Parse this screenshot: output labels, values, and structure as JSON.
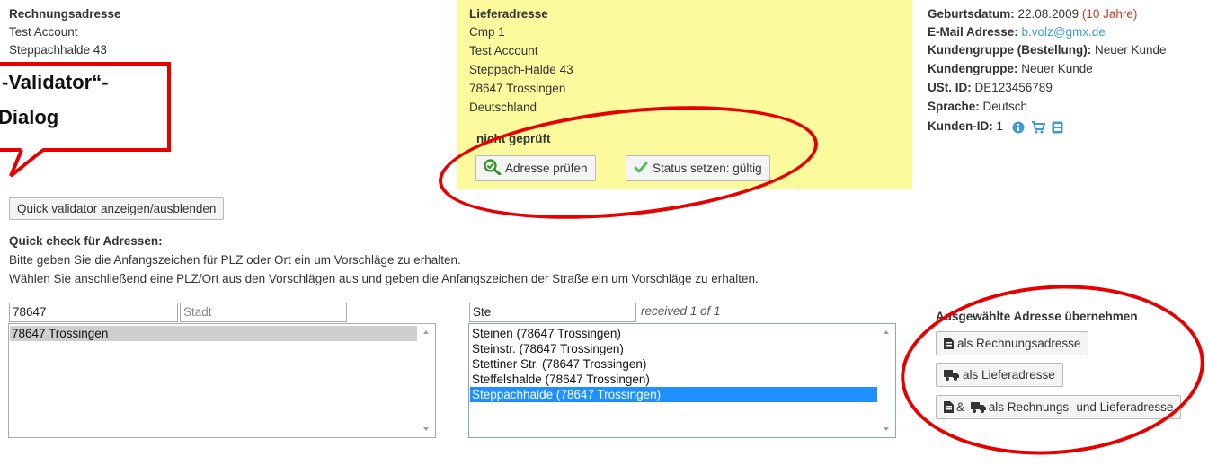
{
  "billing": {
    "heading": "Rechnungsadresse",
    "line1": "Test Account",
    "line2": "Steppachhalde 43"
  },
  "callout": {
    "line1": "-Validator“-",
    "line2": "Dialog"
  },
  "shipping": {
    "heading": "Lieferadresse",
    "line1": "Cmp 1",
    "line2": "Test Account",
    "line3": "Steppach-Halde 43",
    "line4": "78647 Trossingen",
    "line5": "Deutschland",
    "status": "nicht geprüft",
    "check_button": "Adresse prüfen",
    "set_valid_button": "Status setzen: gültig"
  },
  "customer": {
    "birth_label": "Geburtsdatum:",
    "birth_value": " 22.08.2009 ",
    "birth_age": "(10 Jahre)",
    "email_label": "E-Mail Adresse:",
    "email_value": " b.volz@gmx.de",
    "group_order_label": "Kundengruppe (Bestellung):",
    "group_order_value": " Neuer Kunde",
    "group_label": "Kundengruppe:",
    "group_value": " Neuer Kunde",
    "vat_label": "USt. ID:",
    "vat_value": " DE123456789",
    "lang_label": "Sprache:",
    "lang_value": " Deutsch",
    "id_label": "Kunden-ID:",
    "id_value": " 1"
  },
  "toggle_button": "Quick validator anzeigen/ausblenden",
  "quick": {
    "title": "Quick check für Adressen:",
    "hint1": "Bitte geben Sie die Anfangszeichen für PLZ oder Ort ein um Vorschläge zu erhalten.",
    "hint2": "Wählen Sie anschließend eine PLZ/Ort aus den Vorschlägen aus und geben die Anfangszeichen der Straße ein um Vorschläge zu erhalten.",
    "plz_value": "78647",
    "city_placeholder": "Stadt",
    "plz_options": [
      "78647 Trossingen"
    ],
    "street_value": "Ste",
    "received": "received 1 of 1",
    "street_options": [
      "Steinen (78647 Trossingen)",
      "Steinstr. (78647 Trossingen)",
      "Stettiner Str. (78647 Trossingen)",
      "Steffelshalde (78647 Trossingen)",
      "Steppachhalde (78647 Trossingen)"
    ],
    "selected_street_index": 4
  },
  "apply": {
    "title": "Ausgewählte Adresse übernehmen",
    "billing_button": "als Rechnungsadresse",
    "shipping_button": "als Lieferadresse",
    "both_amp": "&",
    "both_button": "als Rechnungs- und Lieferadresse"
  },
  "colors": {
    "highlight": "#fbfb9e",
    "annotation_red": "#e60000",
    "link_blue": "#3c9bd6",
    "age_red": "#c0392b",
    "selection_blue": "#1e90ff"
  }
}
